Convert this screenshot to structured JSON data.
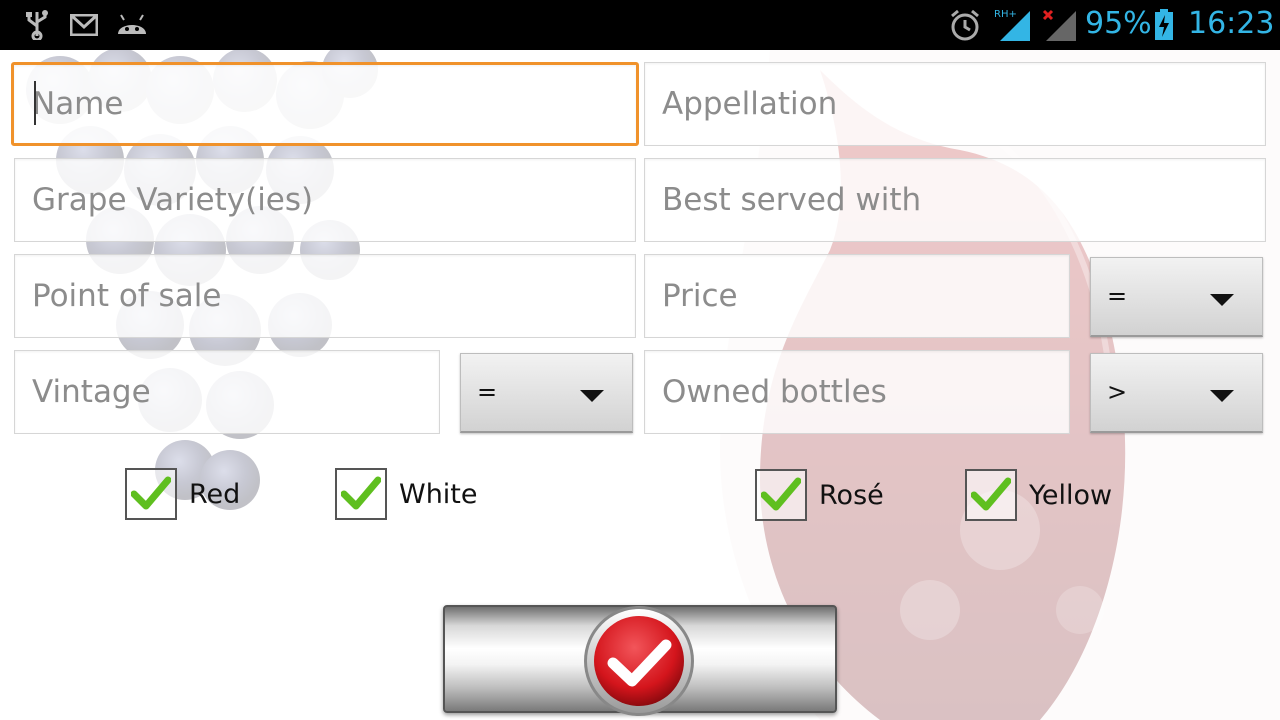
{
  "status_bar": {
    "battery_percent": "95%",
    "time": "16:23",
    "network_label": "RH+",
    "icons": [
      "usb-icon",
      "gmail-icon",
      "android-icon",
      "alarm-icon",
      "signal-icon",
      "no-signal-icon",
      "battery-charging-icon"
    ]
  },
  "form": {
    "name_placeholder": "Name",
    "appellation_placeholder": "Appellation",
    "grape_placeholder": "Grape Variety(ies)",
    "best_served_placeholder": "Best served with",
    "point_of_sale_placeholder": "Point of sale",
    "price_placeholder": "Price",
    "price_operator": "=",
    "vintage_placeholder": "Vintage",
    "vintage_operator": "=",
    "owned_placeholder": "Owned bottles",
    "owned_operator": ">"
  },
  "colors_filter": [
    {
      "label": "Red",
      "checked": true
    },
    {
      "label": "White",
      "checked": true
    },
    {
      "label": "Rosé",
      "checked": true
    },
    {
      "label": "Yellow",
      "checked": true
    }
  ],
  "submit": {
    "icon": "checkmark-icon"
  },
  "theme": {
    "focus": "#f0922b",
    "status_text": "#33b5e5",
    "check_green": "#5fbf1f",
    "submit_red": "#d4151c"
  }
}
